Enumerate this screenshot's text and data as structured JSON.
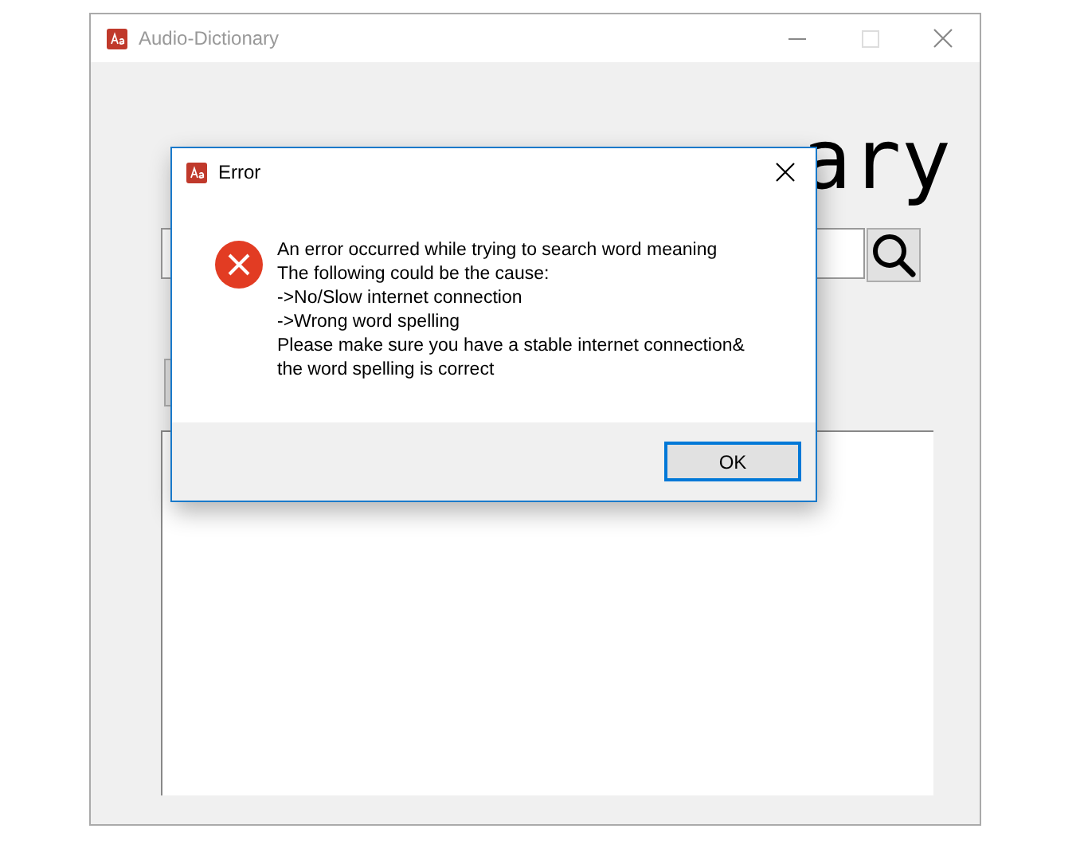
{
  "window": {
    "title": "Audio-Dictionary",
    "controls": [
      {
        "kind": "minimize",
        "disabled": false
      },
      {
        "kind": "maximize",
        "disabled": true
      },
      {
        "kind": "close",
        "disabled": false
      }
    ]
  },
  "heading": "ary",
  "dialog": {
    "title": "Error",
    "message": [
      "An error occurred while trying to search word meaning",
      "The following could be the cause:",
      "->No/Slow internet connection",
      "->Wrong word spelling",
      "Please make sure you have a stable internet connection&",
      "the word spelling is correct"
    ],
    "button": "OK"
  }
}
